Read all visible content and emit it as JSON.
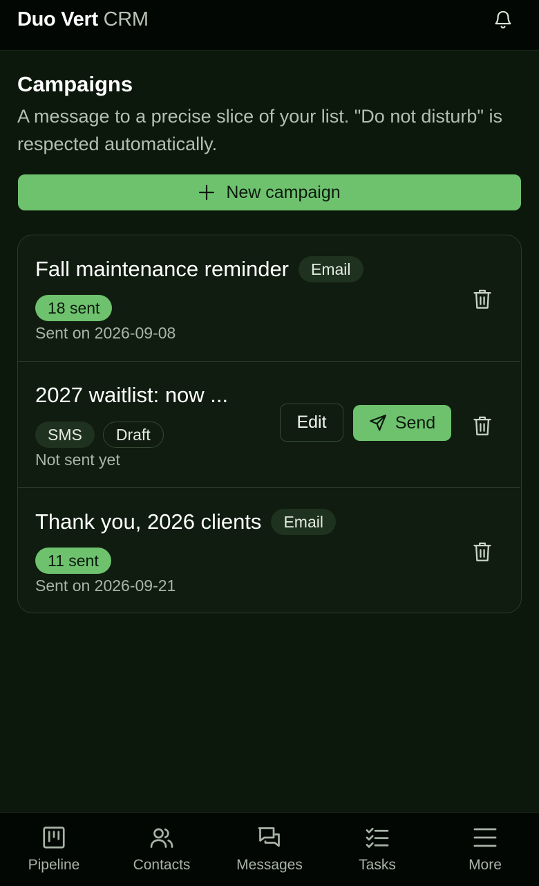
{
  "header": {
    "brand_strong": "Duo Vert",
    "brand_light": "CRM",
    "bell_icon": "bell-icon"
  },
  "main": {
    "title": "Campaigns",
    "description": "A message to a precise slice of your list. \"Do not disturb\" is respected automatically.",
    "new_button_label": "New campaign"
  },
  "campaigns": [
    {
      "title": "Fall maintenance reminder",
      "channel": "Email",
      "sent_badge": "18 sent",
      "meta": "Sent on 2026-09-08"
    },
    {
      "title": "2027 waitlist: now ...",
      "channel": "SMS",
      "status": "Draft",
      "meta": "Not sent yet",
      "edit_label": "Edit",
      "send_label": "Send"
    },
    {
      "title": "Thank you, 2026 clients",
      "channel": "Email",
      "sent_badge": "11 sent",
      "meta": "Sent on 2026-09-21"
    }
  ],
  "nav": [
    {
      "label": "Pipeline",
      "icon": "pipeline-icon"
    },
    {
      "label": "Contacts",
      "icon": "contacts-icon"
    },
    {
      "label": "Messages",
      "icon": "messages-icon"
    },
    {
      "label": "Tasks",
      "icon": "tasks-icon"
    },
    {
      "label": "More",
      "icon": "menu-icon"
    }
  ],
  "colors": {
    "accent": "#6ec26e",
    "background": "#0c180c",
    "header": "#030703"
  }
}
